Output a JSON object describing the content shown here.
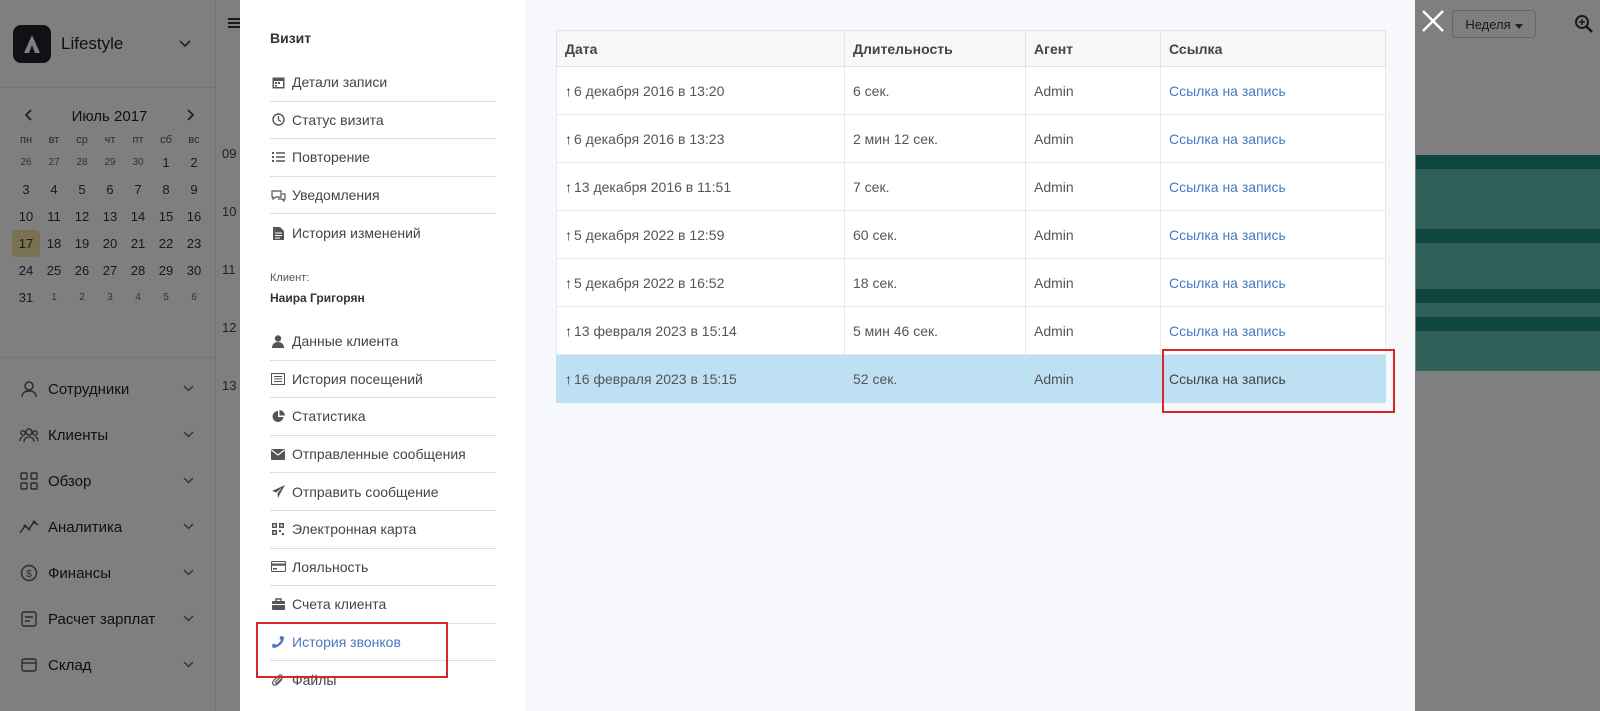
{
  "app": {
    "brand": "Lifestyle",
    "calendar": {
      "month": "Июль 2017",
      "weekdays": [
        "пн",
        "вт",
        "ср",
        "чт",
        "пт",
        "сб",
        "вс"
      ],
      "weeks": [
        [
          "26",
          "27",
          "28",
          "29",
          "30",
          "1",
          "2"
        ],
        [
          "3",
          "4",
          "5",
          "6",
          "7",
          "8",
          "9"
        ],
        [
          "10",
          "11",
          "12",
          "13",
          "14",
          "15",
          "16"
        ],
        [
          "17",
          "18",
          "19",
          "20",
          "21",
          "22",
          "23"
        ],
        [
          "24",
          "25",
          "26",
          "27",
          "28",
          "29",
          "30"
        ],
        [
          "31",
          "1",
          "2",
          "3",
          "4",
          "5",
          "6"
        ]
      ],
      "today": "17"
    },
    "menu": [
      {
        "label": "Сотрудники",
        "icon": "person-icon"
      },
      {
        "label": "Клиенты",
        "icon": "people-icon"
      },
      {
        "label": "Обзор",
        "icon": "grid-icon"
      },
      {
        "label": "Аналитика",
        "icon": "analytics-icon"
      },
      {
        "label": "Финансы",
        "icon": "dollar-icon"
      },
      {
        "label": "Расчет зарплат",
        "icon": "payroll-icon"
      },
      {
        "label": "Склад",
        "icon": "box-icon"
      }
    ],
    "view_select": "Неделя",
    "time_labels": [
      "09",
      "10",
      "11",
      "12",
      "13"
    ]
  },
  "modal": {
    "nav_title": "Визит",
    "visit_items": [
      {
        "label": "Детали записи",
        "icon": "calendar-icon"
      },
      {
        "label": "Статус визита",
        "icon": "clock-icon"
      },
      {
        "label": "Повторение",
        "icon": "list-icon"
      },
      {
        "label": "Уведомления",
        "icon": "chat-icon"
      },
      {
        "label": "История изменений",
        "icon": "document-icon"
      }
    ],
    "client_label": "Клиент:",
    "client_name": "Наира Григорян",
    "client_items": [
      {
        "label": "Данные клиента",
        "icon": "user-icon"
      },
      {
        "label": "История посещений",
        "icon": "history-icon"
      },
      {
        "label": "Статистика",
        "icon": "pie-icon"
      },
      {
        "label": "Отправленные сообщения",
        "icon": "envelope-icon"
      },
      {
        "label": "Отправить сообщение",
        "icon": "send-icon"
      },
      {
        "label": "Электронная карта",
        "icon": "qr-icon"
      },
      {
        "label": "Лояльность",
        "icon": "card-icon"
      },
      {
        "label": "Счета клиента",
        "icon": "briefcase-icon"
      },
      {
        "label": "История звонков",
        "icon": "phone-icon",
        "active": true
      },
      {
        "label": "Файлы",
        "icon": "paperclip-icon"
      }
    ],
    "table": {
      "headers": [
        "Дата",
        "Длительность",
        "Агент",
        "Ссылка"
      ],
      "rows": [
        {
          "date": "6 декабря 2016 в 13:20",
          "duration": "6 сек.",
          "agent": "Admin",
          "link": "Ссылка на запись"
        },
        {
          "date": "6 декабря 2016 в 13:23",
          "duration": "2 мин 12 сек.",
          "agent": "Admin",
          "link": "Ссылка на запись"
        },
        {
          "date": "13 декабря 2016 в 11:51",
          "duration": "7 сек.",
          "agent": "Admin",
          "link": "Ссылка на запись"
        },
        {
          "date": "5 декабря 2022  в 12:59",
          "duration": "60 сек.",
          "agent": "Admin",
          "link": "Ссылка на запись"
        },
        {
          "date": "5 декабря 2022  в 16:52",
          "duration": "18 сек.",
          "agent": "Admin",
          "link": "Ссылка на запись"
        },
        {
          "date": "13 февраля 2023 в 15:14",
          "duration": "5 мин 46 сек.",
          "agent": "Admin",
          "link": "Ссылка на запись"
        },
        {
          "date": "16 февраля 2023 в 15:15",
          "duration": "52 сек.",
          "agent": "Admin",
          "link": "Ссылка на запись",
          "selected": true
        }
      ]
    }
  },
  "colors": {
    "accent_link": "#4a78c2",
    "selected_row": "#bde0f3",
    "highlight": "#d62828",
    "teal": "#1b8f7e"
  }
}
